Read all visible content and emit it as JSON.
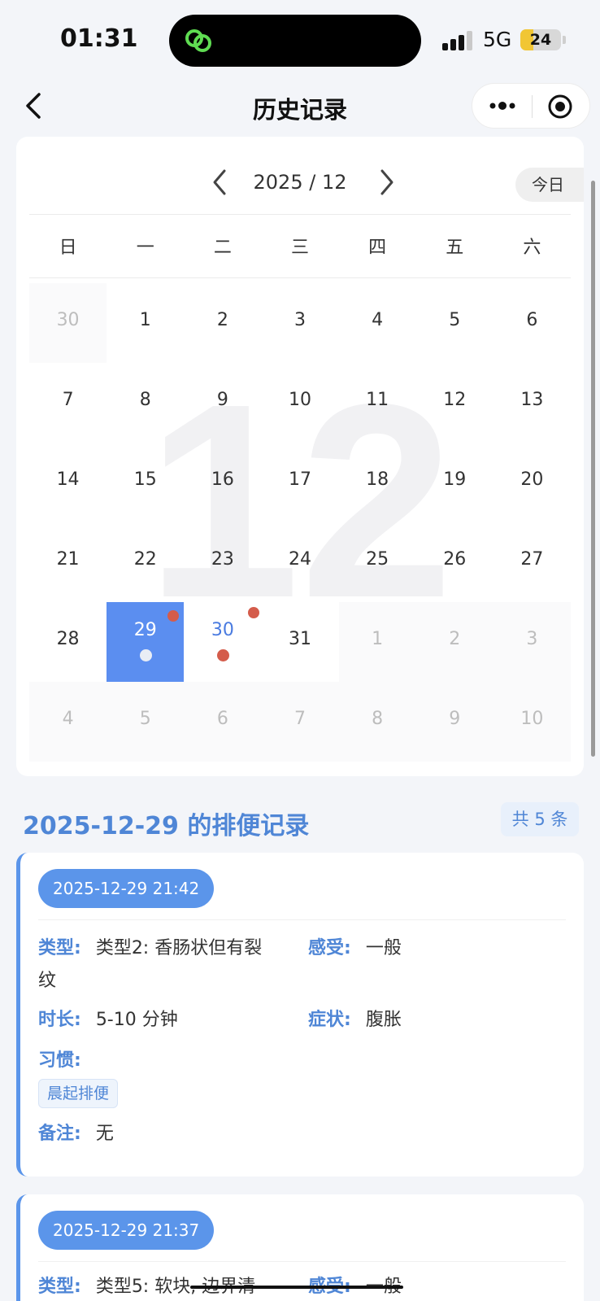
{
  "status_bar": {
    "time": "01:31",
    "network": "5G",
    "battery": "24"
  },
  "nav": {
    "title": "历史记录"
  },
  "calendar": {
    "month_label": "2025 / 12",
    "today_label": "今日",
    "watermark": "12",
    "weekdays": [
      "日",
      "一",
      "二",
      "三",
      "四",
      "五",
      "六"
    ],
    "days": [
      "30",
      "1",
      "2",
      "3",
      "4",
      "5",
      "6",
      "7",
      "8",
      "9",
      "10",
      "11",
      "12",
      "13",
      "14",
      "15",
      "16",
      "17",
      "18",
      "19",
      "20",
      "21",
      "22",
      "23",
      "24",
      "25",
      "26",
      "27",
      "28",
      "29",
      "30",
      "31",
      "1",
      "2",
      "3",
      "4",
      "5",
      "6",
      "7",
      "8",
      "9",
      "10"
    ]
  },
  "section": {
    "title": "2025-12-29 的排便记录",
    "count": "共 5 条"
  },
  "records": [
    {
      "time": "2025-12-29 21:42",
      "type_label": "类型:",
      "type_value": "类型2: 香肠状但有裂",
      "type_value_cont": "纹",
      "feel_label": "感受:",
      "feel_value": "一般",
      "duration_label": "时长:",
      "duration_value": "5-10 分钟",
      "symptom_label": "症状:",
      "symptom_value": "腹胀",
      "habit_label": "习惯:",
      "habit_tag": "晨起排便",
      "note_label": "备注:",
      "note_value": "无"
    },
    {
      "time": "2025-12-29 21:37",
      "type_label": "类型:",
      "type_value": "类型5: 软块, 边界清",
      "feel_label": "感受:",
      "feel_value": "一般"
    }
  ]
}
